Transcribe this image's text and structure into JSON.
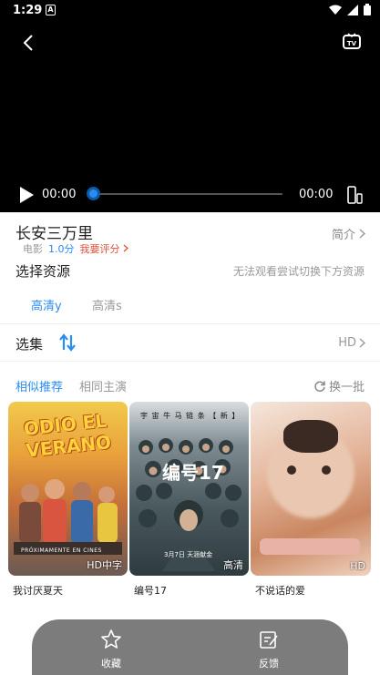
{
  "status_bar": {
    "time": "1:29",
    "notification_letter": "A"
  },
  "player": {
    "current_time": "00:00",
    "total_time": "00:00",
    "progress": 0
  },
  "movie": {
    "title": "长安三万里",
    "intro_label": "简介",
    "type": "电影",
    "score": "1.0分",
    "rate_label": "我要评分"
  },
  "source": {
    "label": "选择资源",
    "hint": "无法观看尝试切换下方资源",
    "tabs": [
      "高清y",
      "高清s"
    ]
  },
  "episodes": {
    "label": "选集",
    "quality": "HD"
  },
  "recommend": {
    "tabs": [
      "相似推荐",
      "相同主演"
    ],
    "refresh_label": "换一批",
    "items": [
      {
        "title": "我讨厌夏天",
        "badge": "HD中字",
        "poster_text": "ODIO EL VERANO",
        "poster_footer": "PRÓXIMAMENTE EN CINES"
      },
      {
        "title": "编号17",
        "badge": "高清",
        "poster_text": "编号17",
        "poster_header": "宇 宙 牛 马   链 条 【 新 】",
        "poster_footer": "3月7日 天涯献金"
      },
      {
        "title": "不说话的爱",
        "badge": "HD"
      }
    ]
  },
  "bottom_bar": {
    "favorite_label": "收藏",
    "feedback_label": "反馈"
  },
  "colors": {
    "accent": "#2a8cf0",
    "rate": "#e2503a",
    "bottom_bar": "#7c7c7c"
  }
}
